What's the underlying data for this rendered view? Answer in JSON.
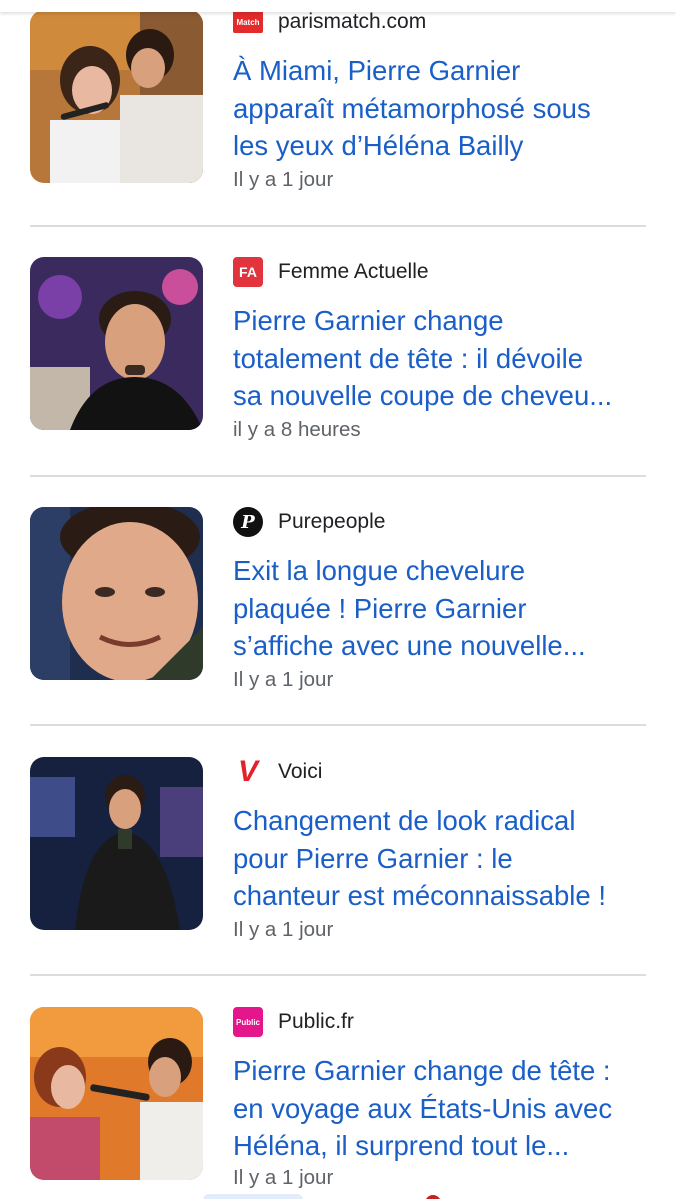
{
  "articles": [
    {
      "source": "parismatch.com",
      "logo_text": "Match",
      "headline_lines": [
        "À Miami, Pierre Garnier",
        "apparaît métamorphosé sous",
        "les yeux d’Héléna Bailly"
      ],
      "time": "Il y a 1 jour",
      "logo_color": "#e32b2b"
    },
    {
      "source": "Femme Actuelle",
      "logo_text": "FA",
      "headline_lines": [
        "Pierre Garnier change",
        "totalement de tête : il dévoile",
        "sa nouvelle coupe de cheveu..."
      ],
      "time": "il y a 8 heures",
      "logo_color": "#e2343c"
    },
    {
      "source": "Purepeople",
      "logo_text": "P",
      "headline_lines": [
        "Exit la longue chevelure",
        "plaquée ! Pierre Garnier",
        "s’affiche avec une nouvelle..."
      ],
      "time": "Il y a 1 jour",
      "logo_color": "#111111"
    },
    {
      "source": "Voici",
      "logo_text": "V",
      "headline_lines": [
        "Changement de look radical",
        "pour Pierre Garnier : le",
        "chanteur est méconnaissable !"
      ],
      "time": "Il y a 1 jour",
      "logo_color": "#e4202a"
    },
    {
      "source": "Public.fr",
      "logo_text": "Public",
      "headline_lines": [
        "Pierre Garnier change de tête :",
        "en voyage aux États-Unis avec",
        "Héléna, il surprend tout le..."
      ],
      "time": "Il y a 1 jour",
      "logo_color": "#e5168b"
    }
  ],
  "colors": {
    "headline": "#1a5fc7",
    "meta": "#5f6368",
    "divider": "#dadce0"
  }
}
